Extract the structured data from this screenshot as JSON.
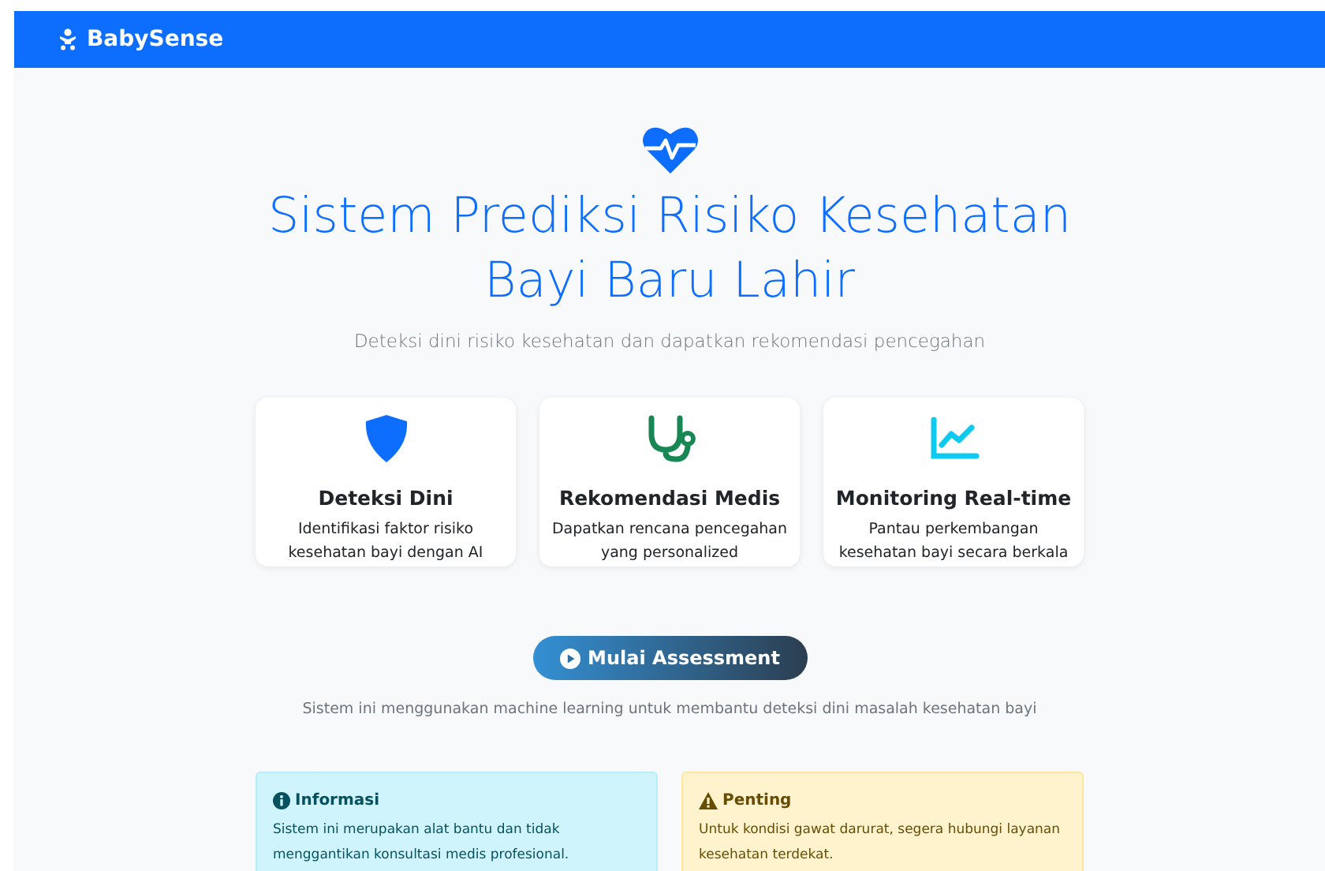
{
  "navbar": {
    "brand": "BabySense"
  },
  "hero": {
    "title": "Sistem Prediksi Risiko Kesehatan Bayi Baru Lahir",
    "subtitle": "Deteksi dini risiko kesehatan dan dapatkan rekomendasi pencegahan"
  },
  "features": [
    {
      "kind": "shield",
      "title": "Deteksi Dini",
      "text": "Identifikasi faktor risiko kesehatan bayi dengan AI"
    },
    {
      "kind": "stethoscope",
      "title": "Rekomendasi Medis",
      "text": "Dapatkan rencana pencegahan yang personalized"
    },
    {
      "kind": "chart",
      "title": "Monitoring Real-time",
      "text": "Pantau perkembangan kesehatan bayi secara berkala"
    }
  ],
  "start_button": {
    "label": "Mulai Assessment"
  },
  "note": "Sistem ini menggunakan machine learning untuk membantu deteksi dini masalah kesehatan bayi",
  "alerts": [
    {
      "kind": "info",
      "title": "Informasi",
      "text": "Sistem ini merupakan alat bantu dan tidak menggantikan konsultasi medis profesional."
    },
    {
      "kind": "warning",
      "title": "Penting",
      "text": "Untuk kondisi gawat darurat, segera hubungi layanan kesehatan terdekat."
    }
  ]
}
